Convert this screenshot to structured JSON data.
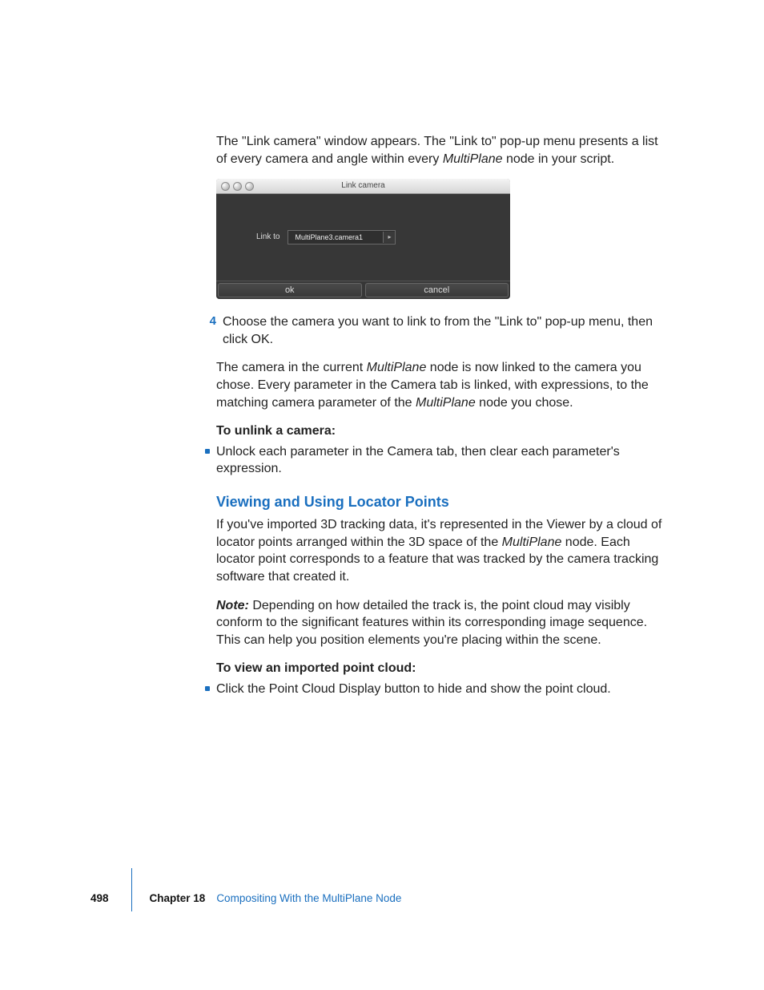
{
  "intro": {
    "p1a": "The \"Link camera\" window appears. The \"Link to\" pop-up menu presents a list of every camera and angle within every ",
    "p1_em": "MultiPlane",
    "p1b": " node in your script."
  },
  "link_camera_window": {
    "title": "Link camera",
    "label": "Link to",
    "popup_value": "MultiPlane3.camera1",
    "ok": "ok",
    "cancel": "cancel"
  },
  "step4": {
    "num": "4",
    "text": "Choose the camera you want to link to from the \"Link to\" pop-up menu, then click OK."
  },
  "after_step": {
    "a": "The camera in the current ",
    "em1": "MultiPlane",
    "b": " node is now linked to the camera you chose. Every parameter in the Camera tab is linked, with expressions, to the matching camera parameter of the ",
    "em2": "MultiPlane",
    "c": " node you chose."
  },
  "unlink": {
    "heading": "To unlink a camera:",
    "bullet": "Unlock each parameter in the Camera tab, then clear each parameter's expression."
  },
  "locator": {
    "heading": "Viewing and Using Locator Points",
    "p_a1": "If you've imported 3D tracking data, it's represented in the Viewer by a cloud of locator points arranged within the 3D space of the ",
    "p_em": "MultiPlane",
    "p_a2": " node. Each locator point corresponds to a feature that was tracked by the camera tracking software that created it.",
    "note_label": "Note:",
    "note_body": "  Depending on how detailed the track is, the point cloud may visibly conform to the significant features within its corresponding image sequence. This can help you position elements you're placing within the scene.",
    "view_heading": "To view an imported point cloud:",
    "view_bullet": "Click the Point Cloud Display button to hide and show the point cloud."
  },
  "footer": {
    "page": "498",
    "chapter_label": "Chapter 18",
    "chapter_title": "Compositing With the MultiPlane Node"
  }
}
